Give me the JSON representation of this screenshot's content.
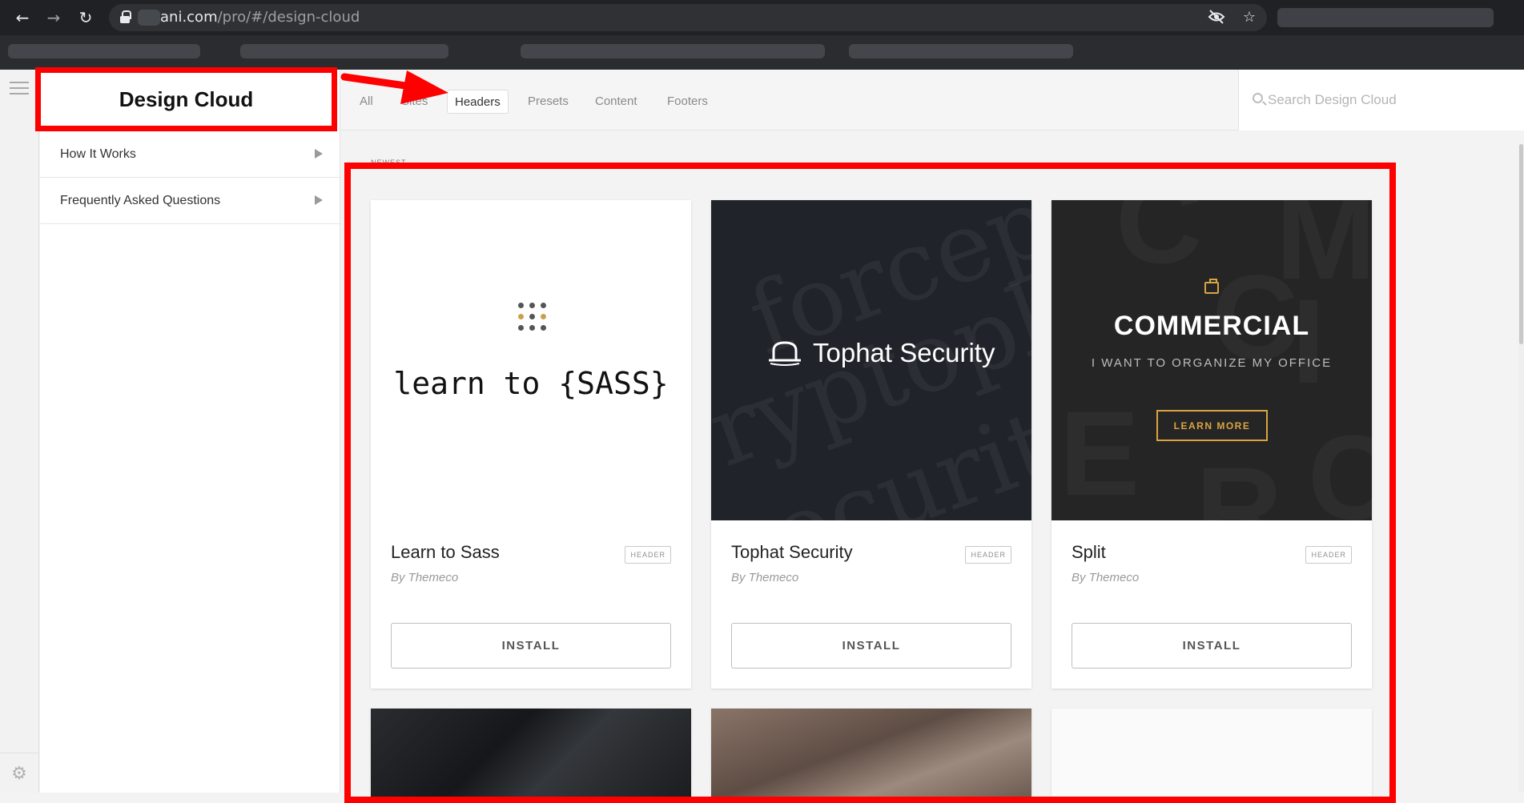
{
  "browser": {
    "url_host": "ani.com",
    "url_path": "/pro/#/design-cloud",
    "back_icon": "back-arrow-icon",
    "forward_icon": "forward-arrow-icon",
    "reload_icon": "reload-icon",
    "tracking_icon": "eye-slash-icon",
    "bookmark_icon": "star-icon"
  },
  "sidebar": {
    "title": "Design Cloud",
    "items": [
      {
        "label": "How It Works"
      },
      {
        "label": "Frequently Asked Questions"
      }
    ]
  },
  "topbar": {
    "tabs": [
      {
        "label": "All",
        "active": false
      },
      {
        "label": "Sites",
        "active": false
      },
      {
        "label": "Headers",
        "active": true
      },
      {
        "label": "Presets",
        "active": false
      },
      {
        "label": "Content",
        "active": false
      },
      {
        "label": "Footers",
        "active": false
      }
    ],
    "search_placeholder": "Search Design Cloud"
  },
  "section_label": "NEWEST",
  "cards": [
    {
      "name": "Learn to Sass",
      "badge": "HEADER",
      "author": "By Themeco",
      "install": "INSTALL",
      "preview_text": "learn to {SASS}"
    },
    {
      "name": "Tophat Security",
      "badge": "HEADER",
      "author": "By Themeco",
      "install": "INSTALL",
      "preview_text": "Tophat Security"
    },
    {
      "name": "Split",
      "badge": "HEADER",
      "author": "By Themeco",
      "install": "INSTALL",
      "preview_title": "COMMERCIAL",
      "preview_subtitle": "I WANT TO ORGANIZE MY OFFICE",
      "preview_button": "LEARN MORE"
    }
  ],
  "colors": {
    "annotation_red": "#ff0000",
    "accent_gold": "#d9a441",
    "dark_card": "#20232a"
  }
}
